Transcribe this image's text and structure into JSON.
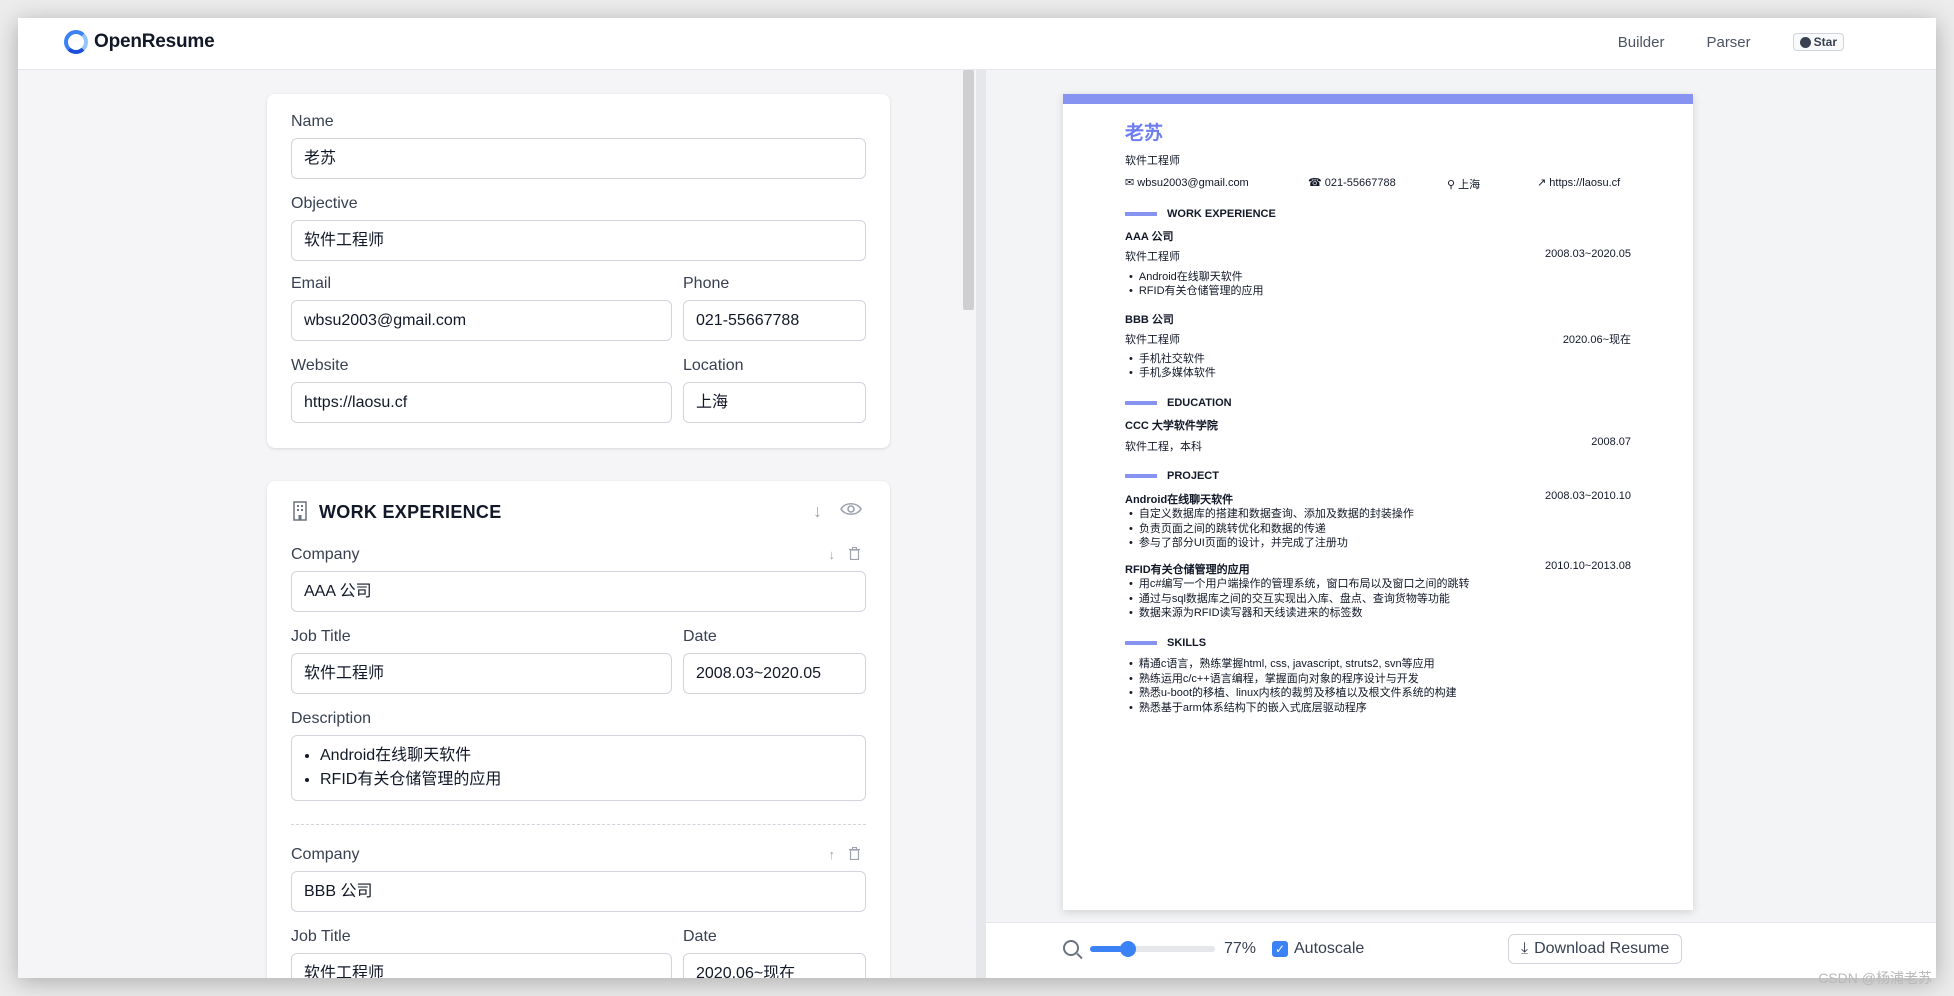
{
  "app": {
    "name": "OpenResume"
  },
  "nav": {
    "builder": "Builder",
    "parser": "Parser",
    "star": "Star"
  },
  "profile": {
    "name_label": "Name",
    "name_value": "老苏",
    "objective_label": "Objective",
    "objective_value": "软件工程师",
    "email_label": "Email",
    "email_value": "wbsu2003@gmail.com",
    "phone_label": "Phone",
    "phone_value": "021-55667788",
    "website_label": "Website",
    "website_value": "https://laosu.cf",
    "location_label": "Location",
    "location_value": "上海"
  },
  "work": {
    "title": "WORK EXPERIENCE",
    "company_label": "Company",
    "job_label": "Job Title",
    "date_label": "Date",
    "desc_label": "Description",
    "entries": [
      {
        "company": "AAA 公司",
        "job": "软件工程师",
        "date": "2008.03~2020.05",
        "bullets": [
          "Android在线聊天软件",
          "RFID有关仓储管理的应用"
        ]
      },
      {
        "company": "BBB 公司",
        "job": "软件工程师",
        "date": "2020.06~现在"
      }
    ]
  },
  "resume": {
    "name": "老苏",
    "objective": "软件工程师",
    "email": "wbsu2003@gmail.com",
    "phone": "021-55667788",
    "location": "上海",
    "website": "https://laosu.cf",
    "work_title": "WORK EXPERIENCE",
    "w1_company": "AAA 公司",
    "w1_job": "软件工程师",
    "w1_date": "2008.03~2020.05",
    "w1_b1": "Android在线聊天软件",
    "w1_b2": "RFID有关仓储管理的应用",
    "w2_company": "BBB 公司",
    "w2_job": "软件工程师",
    "w2_date": "2020.06~现在",
    "w2_b1": "手机社交软件",
    "w2_b2": "手机多媒体软件",
    "edu_title": "EDUCATION",
    "edu_school": "CCC 大学软件学院",
    "edu_degree": "软件工程，本科",
    "edu_date": "2008.07",
    "proj_title": "PROJECT",
    "p1_name": "Android在线聊天软件",
    "p1_date": "2008.03~2010.10",
    "p1_b1": "自定义数据库的搭建和数据查询、添加及数据的封装操作",
    "p1_b2": "负责页面之间的跳转优化和数据的传递",
    "p1_b3": "参与了部分UI页面的设计，并完成了注册功",
    "p2_name": "RFID有关仓储管理的应用",
    "p2_date": "2010.10~2013.08",
    "p2_b1": "用c#编写一个用户端操作的管理系统，窗口布局以及窗口之间的跳转",
    "p2_b2": "通过与sql数据库之间的交互实现出入库、盘点、查询货物等功能",
    "p2_b3": "数据来源为RFID读写器和天线读进来的标签数",
    "skills_title": "SKILLS",
    "s1": "精通c语言，熟练掌握html, css, javascript, struts2, svn等应用",
    "s2": "熟练运用c/c++语言编程，掌握面向对象的程序设计与开发",
    "s3": "熟悉u-boot的移植、linux内核的裁剪及移植以及根文件系统的构建",
    "s4": "熟悉基于arm体系结构下的嵌入式底层驱动程序"
  },
  "controls": {
    "zoom": "77%",
    "zoom_fraction": 0.3,
    "autoscale": "Autoscale",
    "download": "Download Resume"
  },
  "watermark": "CSDN @杨浦老苏",
  "colors": {
    "accent": "#3b82f6",
    "resume_theme": "#8693f0"
  }
}
